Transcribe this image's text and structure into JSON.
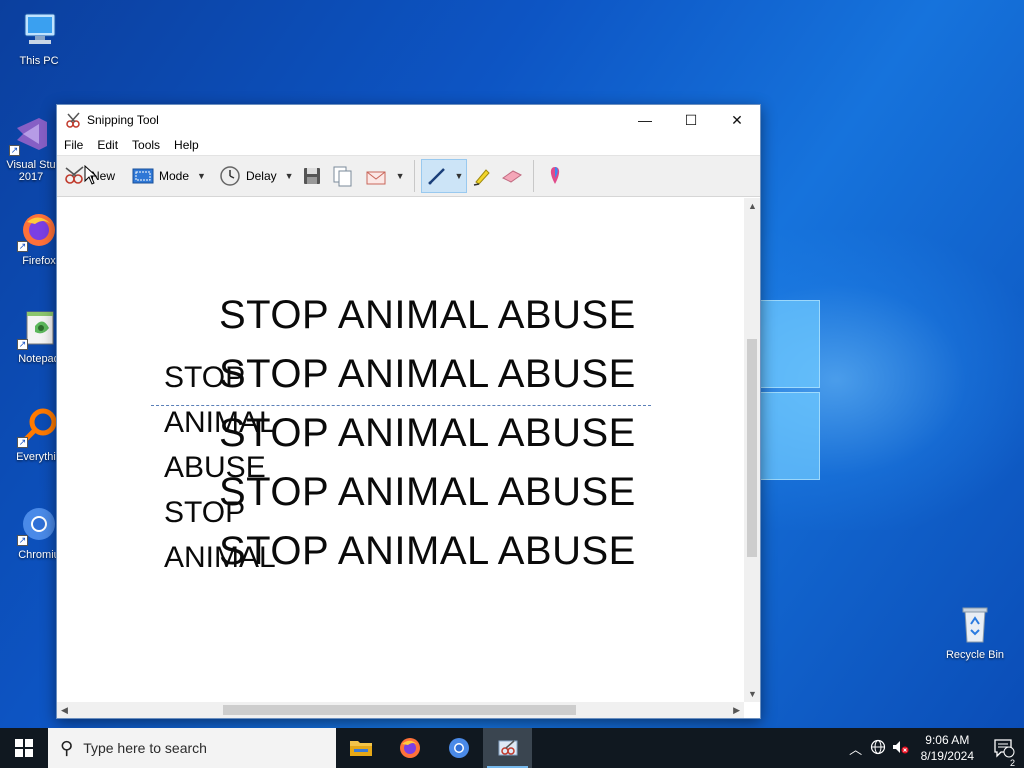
{
  "desktop": {
    "icons": [
      {
        "label": "This PC",
        "icon": "computer-icon"
      },
      {
        "label": "Visual Stu\n2017",
        "icon": "visual-studio-icon"
      },
      {
        "label": "Firefox",
        "icon": "firefox-icon"
      },
      {
        "label": "Notepad",
        "icon": "notepad-icon"
      },
      {
        "label": "Everythin",
        "icon": "everything-search-icon"
      },
      {
        "label": "Chromiu",
        "icon": "chromium-icon"
      },
      {
        "label": "Recycle Bin",
        "icon": "recycle-bin-icon"
      }
    ]
  },
  "window": {
    "title": "Snipping Tool",
    "controls": {
      "minimize": "—",
      "maximize": "☐",
      "close": "✕"
    },
    "menu": [
      "File",
      "Edit",
      "Tools",
      "Help"
    ],
    "toolbar": {
      "new_label": "New",
      "mode_label": "Mode",
      "delay_label": "Delay",
      "icons": [
        "scissors-icon",
        "mode-icon",
        "clock-icon",
        "save-icon",
        "copy-icon",
        "send-email-icon",
        "pen-icon",
        "highlighter-icon",
        "eraser-icon",
        "paint3d-icon"
      ]
    },
    "canvas": {
      "big_lines": [
        "STOP ANIMAL ABUSE",
        "STOP ANIMAL ABUSE",
        "STOP ANIMAL ABUSE",
        "STOP ANIMAL ABUSE",
        "STOP ANIMAL ABUSE"
      ],
      "small_lines": [
        "STOP",
        "ANIMAL",
        "ABUSE",
        "STOP",
        "ANIMAL"
      ]
    }
  },
  "taskbar": {
    "search_placeholder": "Type here to search",
    "apps": [
      "file-explorer-icon",
      "firefox-icon",
      "chromium-icon",
      "snipping-tool-icon"
    ],
    "time": "9:06 AM",
    "date": "8/19/2024",
    "notification_count": "2"
  },
  "colors": {
    "accent": "#0078d7",
    "taskbar": "#101820",
    "pen_active": "#cce4f7"
  }
}
